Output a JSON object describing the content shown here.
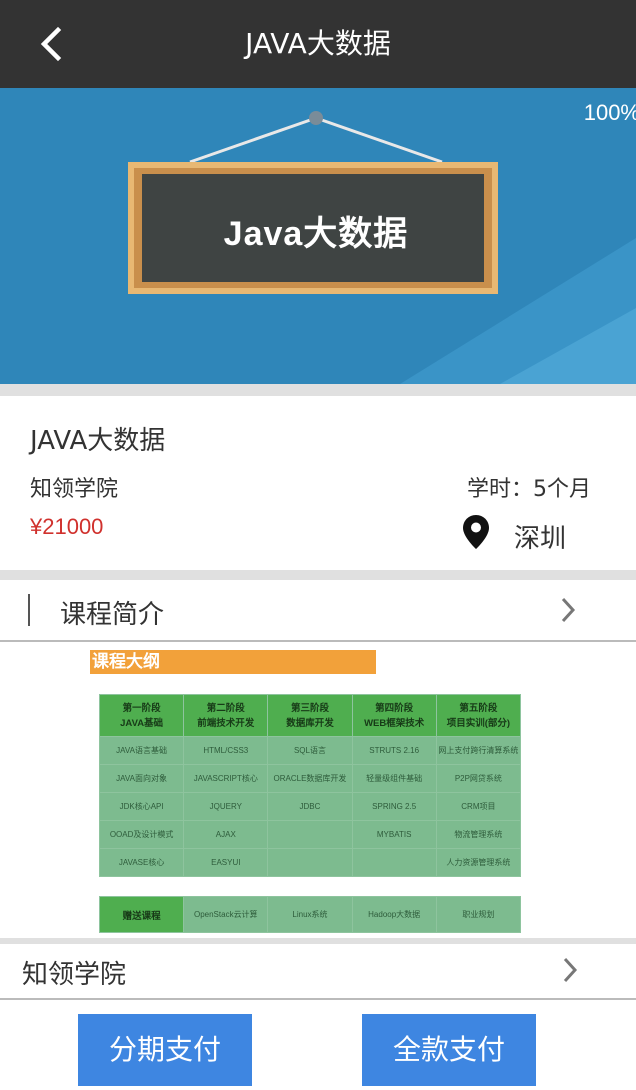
{
  "header": {
    "title": "JAVA大数据",
    "back_icon": "chevron-left-icon"
  },
  "banner": {
    "percent": "100%",
    "board_text": "Java大数据",
    "color": "#2f86b9"
  },
  "course": {
    "title": "JAVA大数据",
    "school": "知领学院",
    "price": "¥21000",
    "hours": "学时：5个月",
    "location_icon": "location-pin-icon",
    "city": "深圳",
    "price_color": "#d0312d"
  },
  "intro": {
    "label": "课程简介",
    "chevron_icon": "chevron-right-icon"
  },
  "outline": {
    "heading": "课程大纲",
    "stages": [
      {
        "phase": "第一阶段",
        "name": "JAVA基础"
      },
      {
        "phase": "第二阶段",
        "name": "前端技术开发"
      },
      {
        "phase": "第三阶段",
        "name": "数据库开发"
      },
      {
        "phase": "第四阶段",
        "name": "WEB框架技术"
      },
      {
        "phase": "第五阶段",
        "name": "项目实训(部分)"
      }
    ],
    "rows": [
      [
        "JAVA语言基础",
        "HTML/CSS3",
        "SQL语言",
        "STRUTS 2.16",
        "网上支付跨行清算系统"
      ],
      [
        "JAVA面向对象",
        "JAVASCRIPT核心",
        "ORACLE数据库开发",
        "轻量级组件基础",
        "P2P网贷系统"
      ],
      [
        "JDK核心API",
        "JQUERY",
        "JDBC",
        "SPRING 2.5",
        "CRM项目"
      ],
      [
        "OOAD及设计模式",
        "AJAX",
        "",
        "MYBATIS",
        "物流管理系统"
      ],
      [
        "JAVASE核心",
        "EASYUI",
        "",
        "",
        "人力资源管理系统"
      ]
    ],
    "bonus": [
      "赠送课程",
      "OpenStack云计算",
      "Linux系统",
      "Hadoop大数据",
      "职业规划"
    ]
  },
  "school_row": {
    "label": "知领学院",
    "chevron_icon": "chevron-right-icon"
  },
  "actions": {
    "installment": "分期支付",
    "full": "全款支付",
    "button_color": "#3e86e1"
  }
}
